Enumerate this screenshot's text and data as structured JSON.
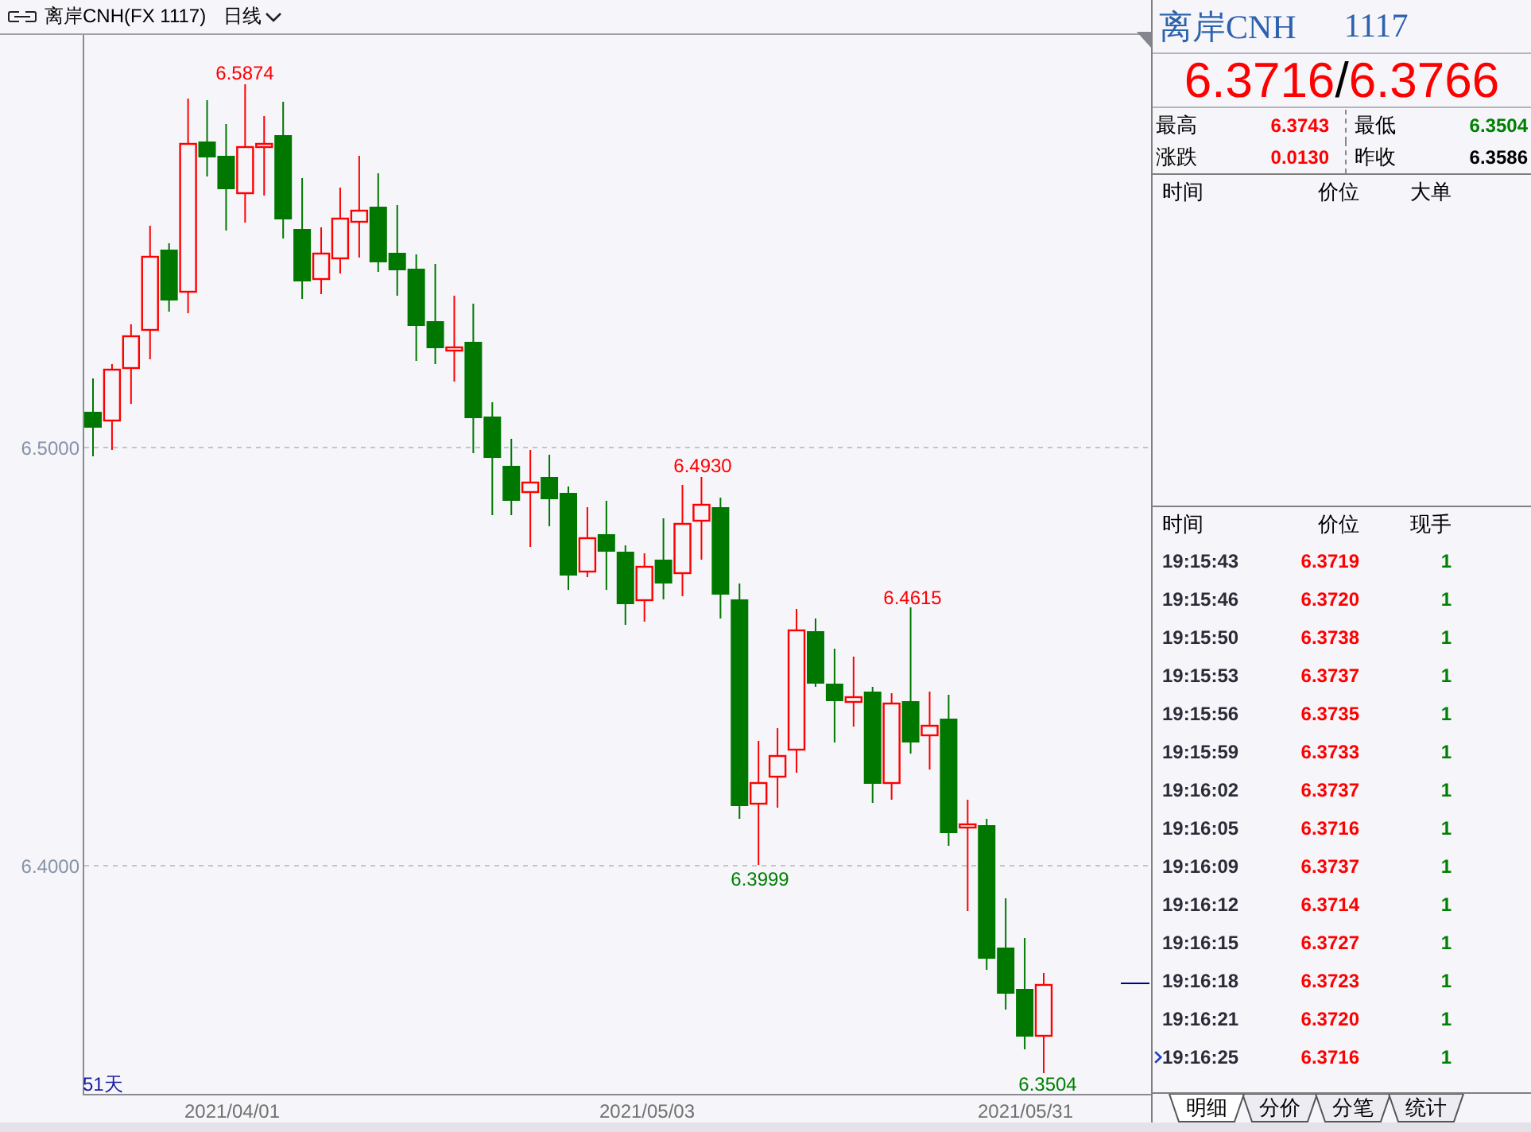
{
  "header": {
    "instrument": "离岸CNH(FX 1117)",
    "period": "日线"
  },
  "chart": {
    "y_ticks": [
      "6.5000",
      "6.4000"
    ],
    "x_labels": [
      "2021/04/01",
      "2021/05/03",
      "2021/05/31"
    ],
    "bar_count": "51天",
    "annotations": [
      {
        "text": "6.5874",
        "kind": "high"
      },
      {
        "text": "6.4930",
        "kind": "high"
      },
      {
        "text": "6.4615",
        "kind": "high"
      },
      {
        "text": "6.3999",
        "kind": "low"
      },
      {
        "text": "6.3504",
        "kind": "low"
      }
    ]
  },
  "quote": {
    "name": "离岸CNH",
    "code": "1117",
    "bid": "6.3716",
    "separator": "/",
    "ask": "6.3766",
    "stats": [
      {
        "label": "最高",
        "value": "6.3743",
        "color": "#ff0000"
      },
      {
        "label": "最低",
        "value": "6.3504",
        "color": "#008000"
      },
      {
        "label": "涨跌",
        "value": "0.0130",
        "color": "#ff0000"
      },
      {
        "label": "昨收",
        "value": "6.3586",
        "color": "#000000"
      }
    ]
  },
  "big_orders": {
    "columns": [
      "时间",
      "价位",
      "大单"
    ]
  },
  "trades": {
    "columns": [
      "时间",
      "价位",
      "现手"
    ],
    "rows": [
      {
        "time": "19:15:43",
        "price": "6.3719",
        "volume": "1",
        "pointer": false
      },
      {
        "time": "19:15:46",
        "price": "6.3720",
        "volume": "1",
        "pointer": false
      },
      {
        "time": "19:15:50",
        "price": "6.3738",
        "volume": "1",
        "pointer": false
      },
      {
        "time": "19:15:53",
        "price": "6.3737",
        "volume": "1",
        "pointer": false
      },
      {
        "time": "19:15:56",
        "price": "6.3735",
        "volume": "1",
        "pointer": false
      },
      {
        "time": "19:15:59",
        "price": "6.3733",
        "volume": "1",
        "pointer": false
      },
      {
        "time": "19:16:02",
        "price": "6.3737",
        "volume": "1",
        "pointer": false
      },
      {
        "time": "19:16:05",
        "price": "6.3716",
        "volume": "1",
        "pointer": false
      },
      {
        "time": "19:16:09",
        "price": "6.3737",
        "volume": "1",
        "pointer": false
      },
      {
        "time": "19:16:12",
        "price": "6.3714",
        "volume": "1",
        "pointer": false
      },
      {
        "time": "19:16:15",
        "price": "6.3727",
        "volume": "1",
        "pointer": false
      },
      {
        "time": "19:16:18",
        "price": "6.3723",
        "volume": "1",
        "pointer": false
      },
      {
        "time": "19:16:21",
        "price": "6.3720",
        "volume": "1",
        "pointer": false
      },
      {
        "time": "19:16:25",
        "price": "6.3716",
        "volume": "1",
        "pointer": true
      }
    ]
  },
  "tabs": [
    {
      "label": "明细",
      "selected": true
    },
    {
      "label": "分价",
      "selected": false
    },
    {
      "label": "分笔",
      "selected": false
    },
    {
      "label": "统计",
      "selected": false
    }
  ]
}
